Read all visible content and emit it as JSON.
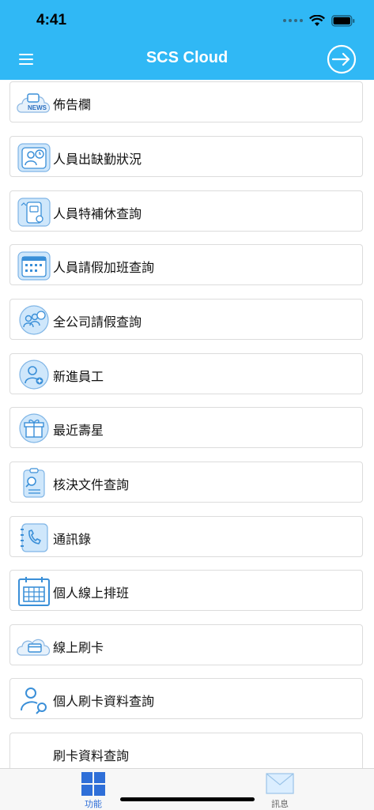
{
  "status": {
    "time": "4:41"
  },
  "header": {
    "title": "SCS Cloud"
  },
  "menu": [
    {
      "label": "佈告欄",
      "icon": "news-cloud-icon",
      "badge": "NEWS"
    },
    {
      "label": "人員出缺勤狀況",
      "icon": "attendance-icon"
    },
    {
      "label": "人員特補休查詢",
      "icon": "special-leave-icon"
    },
    {
      "label": "人員請假加班查詢",
      "icon": "leave-overtime-calendar-icon"
    },
    {
      "label": "全公司請假查詢",
      "icon": "company-leave-icon"
    },
    {
      "label": "新進員工",
      "icon": "new-employee-icon"
    },
    {
      "label": "最近壽星",
      "icon": "birthday-gift-icon"
    },
    {
      "label": "核決文件查詢",
      "icon": "document-search-icon"
    },
    {
      "label": "通訊錄",
      "icon": "phone-book-icon"
    },
    {
      "label": "個人線上排班",
      "icon": "schedule-calendar-icon"
    },
    {
      "label": "線上刷卡",
      "icon": "card-swipe-cloud-icon"
    },
    {
      "label": "個人刷卡資料查詢",
      "icon": "personal-card-search-icon"
    },
    {
      "label": "刷卡資料查詢",
      "icon": ""
    }
  ],
  "tabs": [
    {
      "label": "功能",
      "icon": "grid-icon",
      "color": "#2f6fd8",
      "active": true
    },
    {
      "label": "訊息",
      "icon": "mail-icon",
      "color": "#666666",
      "active": false
    }
  ],
  "colors": {
    "accent": "#30b8f5",
    "icon_blue": "#3a8fd8"
  }
}
